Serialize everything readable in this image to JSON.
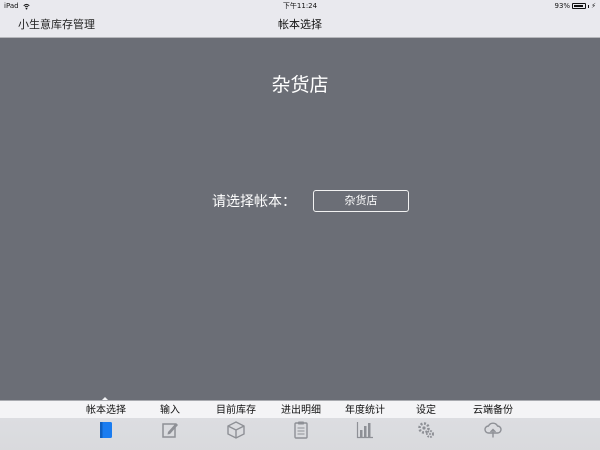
{
  "status_bar": {
    "device": "iPad",
    "time": "下午11:24",
    "battery": "93%",
    "battery_level": 0.93
  },
  "nav": {
    "back_label": "小生意库存管理",
    "title": "帐本选择"
  },
  "main": {
    "store_title": "杂货店",
    "picker_label": "请选择帐本：",
    "picker_value": "杂货店"
  },
  "tabs": [
    {
      "label": "帐本选择",
      "icon": "book-icon",
      "selected": true
    },
    {
      "label": "输入",
      "icon": "edit-icon",
      "selected": false
    },
    {
      "label": "目前库存",
      "icon": "box-icon",
      "selected": false
    },
    {
      "label": "进出明细",
      "icon": "clipboard-icon",
      "selected": false
    },
    {
      "label": "年度统计",
      "icon": "bar-chart-icon",
      "selected": false
    },
    {
      "label": "设定",
      "icon": "gears-icon",
      "selected": false
    },
    {
      "label": "云端备份",
      "icon": "cloud-upload-icon",
      "selected": false
    }
  ],
  "colors": {
    "background": "#6b6e76",
    "bar_background": "#e9e9ee",
    "selected_tab_icon": "#1a7cf0",
    "unselected_tab_icon": "#8e9096"
  }
}
